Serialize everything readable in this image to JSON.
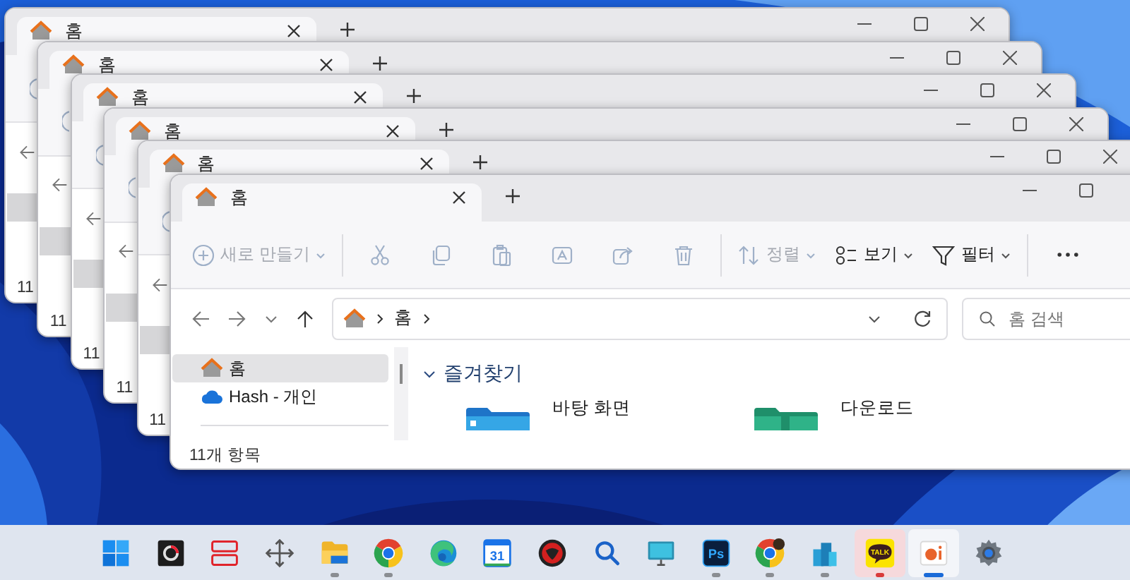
{
  "windows": [
    {
      "tab_title": "홈",
      "controls": [
        {
          "kind": "minimize"
        },
        {
          "kind": "maximize"
        },
        {
          "kind": "close"
        }
      ],
      "status": "11"
    },
    {
      "tab_title": "홈",
      "controls": [
        {
          "kind": "minimize"
        },
        {
          "kind": "maximize"
        },
        {
          "kind": "close"
        }
      ],
      "status": "11"
    },
    {
      "tab_title": "홈",
      "controls": [
        {
          "kind": "minimize"
        },
        {
          "kind": "maximize"
        },
        {
          "kind": "close"
        }
      ],
      "status": "11"
    },
    {
      "tab_title": "홈",
      "controls": [
        {
          "kind": "minimize"
        },
        {
          "kind": "maximize"
        },
        {
          "kind": "close"
        }
      ],
      "status": "11"
    },
    {
      "tab_title": "홈",
      "controls": [
        {
          "kind": "minimize"
        },
        {
          "kind": "maximize"
        },
        {
          "kind": "close"
        }
      ],
      "status": "11"
    },
    {
      "tab_title": "홈",
      "controls": [
        {
          "kind": "minimize"
        },
        {
          "kind": "maximize"
        }
      ],
      "toolbar": [
        {
          "kind": "new",
          "label": "새로 만들기",
          "disabled": true
        },
        {
          "kind": "cut",
          "disabled": true
        },
        {
          "kind": "copy",
          "disabled": true
        },
        {
          "kind": "paste",
          "disabled": true
        },
        {
          "kind": "rename",
          "disabled": true
        },
        {
          "kind": "share",
          "disabled": true
        },
        {
          "kind": "delete",
          "disabled": true
        },
        {
          "kind": "sort",
          "label": "정렬",
          "disabled": true
        },
        {
          "kind": "view",
          "label": "보기",
          "disabled": false
        },
        {
          "kind": "filter",
          "label": "필터",
          "disabled": false
        },
        {
          "kind": "more",
          "disabled": false
        }
      ],
      "address": {
        "path": [
          "홈"
        ]
      },
      "search": {
        "placeholder": "홈 검색"
      },
      "sidebar": [
        {
          "kind": "home",
          "label": "홈",
          "selected": true
        },
        {
          "kind": "cloud",
          "label": "Hash - 개인",
          "selected": false
        }
      ],
      "section": {
        "title": "즐겨찾기",
        "expanded": true,
        "items": [
          {
            "kind": "desktop",
            "name": "바탕 화면"
          },
          {
            "kind": "downloads",
            "name": "다운로드"
          }
        ]
      },
      "status": "11개 항목"
    }
  ],
  "taskbar": [
    {
      "kind": "start",
      "running": false,
      "active": false,
      "flashing": false
    },
    {
      "kind": "recorder",
      "running": false,
      "active": false,
      "flashing": false
    },
    {
      "kind": "layout",
      "running": false,
      "active": false,
      "flashing": false
    },
    {
      "kind": "move",
      "running": false,
      "active": false,
      "flashing": false
    },
    {
      "kind": "explorer",
      "running": true,
      "active": false,
      "flashing": false
    },
    {
      "kind": "chrome",
      "running": true,
      "active": false,
      "flashing": false
    },
    {
      "kind": "edge",
      "running": false,
      "active": false,
      "flashing": false
    },
    {
      "kind": "calendar",
      "label": "31",
      "running": false,
      "active": false,
      "flashing": false
    },
    {
      "kind": "redapp",
      "running": false,
      "active": false,
      "flashing": false
    },
    {
      "kind": "search",
      "running": false,
      "active": false,
      "flashing": false
    },
    {
      "kind": "monitor",
      "running": false,
      "active": false,
      "flashing": false
    },
    {
      "kind": "photoshop",
      "label": "Ps",
      "running": true,
      "active": false,
      "flashing": false
    },
    {
      "kind": "chrome-profile",
      "running": true,
      "active": false,
      "flashing": false
    },
    {
      "kind": "buildings",
      "running": true,
      "active": false,
      "flashing": false
    },
    {
      "kind": "kakao",
      "label": "TALK",
      "running": true,
      "active": false,
      "flashing": true
    },
    {
      "kind": "slides",
      "running": true,
      "active": true,
      "flashing": false
    },
    {
      "kind": "settings",
      "running": false,
      "active": false,
      "flashing": false
    }
  ]
}
